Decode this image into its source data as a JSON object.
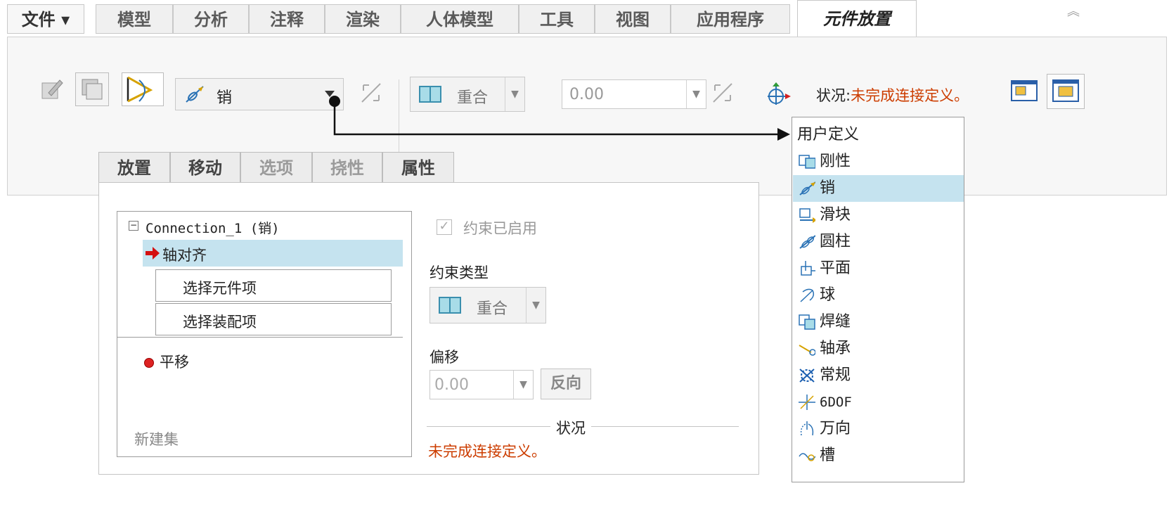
{
  "menu": {
    "tabs": [
      "文件 ▾",
      "模型",
      "分析",
      "注释",
      "渲染",
      "人体模型",
      "工具",
      "视图",
      "应用程序"
    ],
    "active_tab": "元件放置"
  },
  "ribbon": {
    "connection_type": "销",
    "constraint_type": "重合",
    "offset_value": "0.00",
    "status_label": "状况:",
    "status_value": "未完成连接定义。"
  },
  "subtabs": [
    "放置",
    "移动",
    "选项",
    "挠性",
    "属性"
  ],
  "placement": {
    "connection_node": "Connection_1 (销)",
    "axis_align": "轴对齐",
    "select_component": "选择元件项",
    "select_assembly": "选择装配项",
    "translation": "平移",
    "new_set": "新建集",
    "constraint_enabled": "约束已启用",
    "constraint_type_label": "约束类型",
    "constraint_type_value": "重合",
    "offset_label": "偏移",
    "offset_value": "0.00",
    "flip_button": "反向",
    "status_title": "状况",
    "status_text": "未完成连接定义。"
  },
  "dropdown": {
    "header": "用户定义",
    "items": [
      "刚性",
      "销",
      "滑块",
      "圆柱",
      "平面",
      "球",
      "焊缝",
      "轴承",
      "常规",
      "6DOF",
      "万向",
      "槽"
    ],
    "selected": "销"
  },
  "colors": {
    "status_text": "#cc3d00",
    "selection_highlight": "#c5e3ef",
    "accent_icon": "#3a8fae"
  }
}
